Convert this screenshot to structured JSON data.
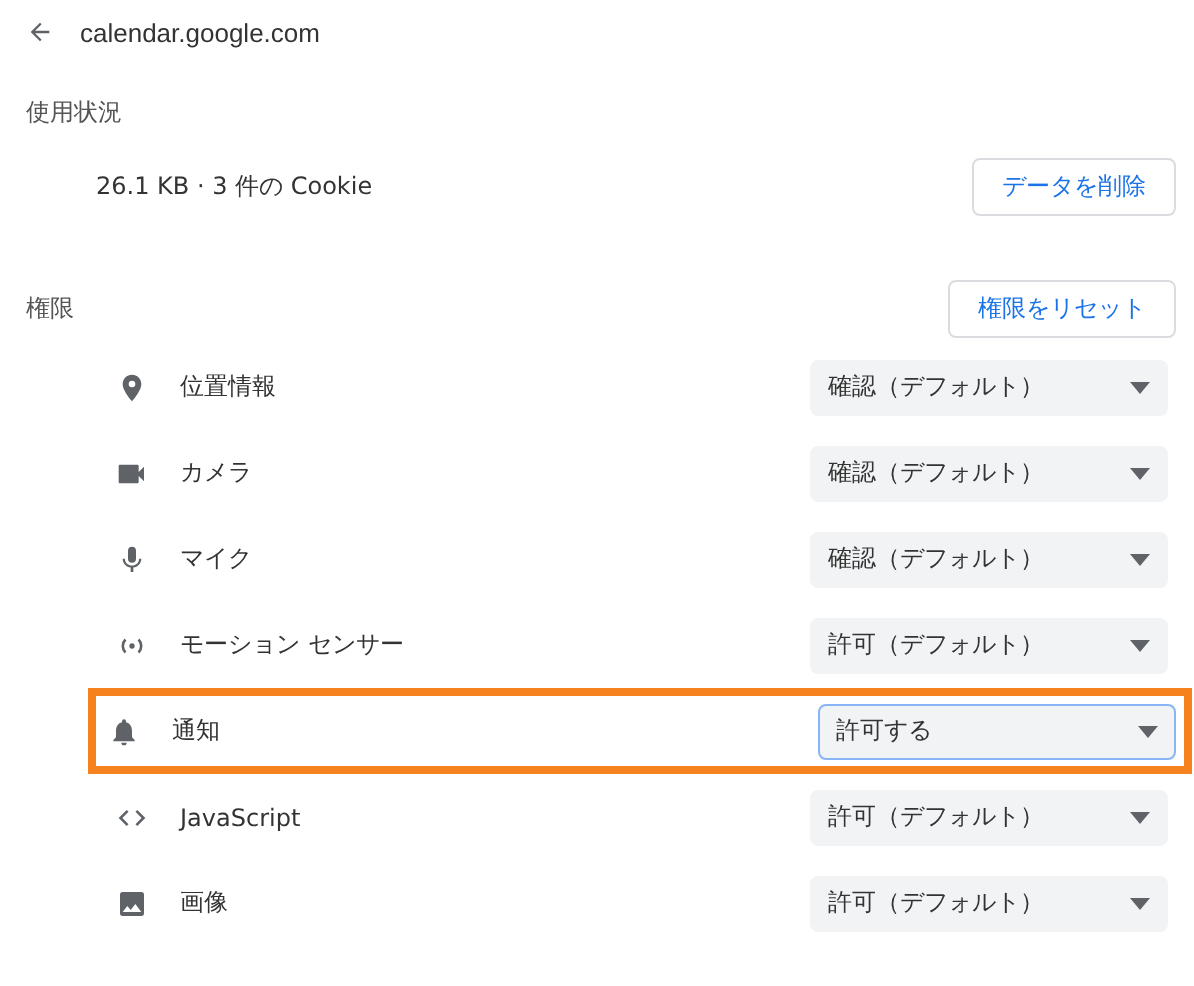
{
  "header": {
    "title": "calendar.google.com"
  },
  "usage": {
    "heading": "使用状況",
    "summary": "26.1 KB · 3 件の Cookie",
    "button": "データを削除"
  },
  "permissions": {
    "heading": "権限",
    "reset_button": "権限をリセット",
    "rows": [
      {
        "label": "位置情報",
        "value": "確認（デフォルト）",
        "highlighted": false,
        "focused": false
      },
      {
        "label": "カメラ",
        "value": "確認（デフォルト）",
        "highlighted": false,
        "focused": false
      },
      {
        "label": "マイク",
        "value": "確認（デフォルト）",
        "highlighted": false,
        "focused": false
      },
      {
        "label": "モーション センサー",
        "value": "許可（デフォルト）",
        "highlighted": false,
        "focused": false
      },
      {
        "label": "通知",
        "value": "許可する",
        "highlighted": true,
        "focused": true
      },
      {
        "label": "JavaScript",
        "value": "許可（デフォルト）",
        "highlighted": false,
        "focused": false
      },
      {
        "label": "画像",
        "value": "許可（デフォルト）",
        "highlighted": false,
        "focused": false
      }
    ]
  }
}
